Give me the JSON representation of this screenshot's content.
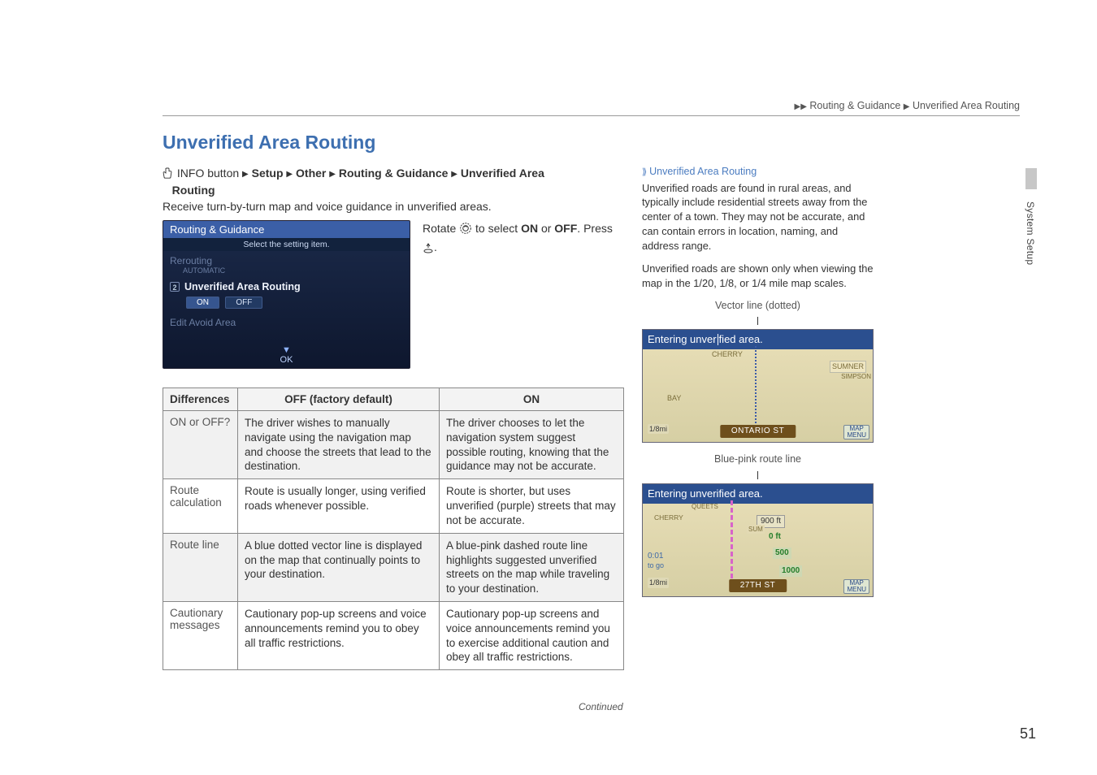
{
  "header": {
    "path_part1": "Routing & Guidance",
    "path_part2": "Unverified Area Routing"
  },
  "section_title": "Unverified Area Routing",
  "instruction": {
    "prefix": "INFO button",
    "p1": "Setup",
    "p2": "Other",
    "p3": "Routing & Guidance",
    "p4": "Unverified Area",
    "p5": "Routing"
  },
  "lead": "Receive turn-by-turn map and voice guidance in unverified areas.",
  "screenshot": {
    "title": "Routing & Guidance",
    "sub": "Select the setting item.",
    "dim1": "Rerouting",
    "dim1b": "AUTOMATIC",
    "row2": "Unverified Area Routing",
    "num": "2",
    "on": "ON",
    "off": "OFF",
    "dim3": "Edit Avoid Area",
    "ok": "OK"
  },
  "rotate": {
    "pre": "Rotate ",
    "mid": " to select ",
    "on": "ON",
    "or": " or ",
    "off": "OFF",
    "post": ". Press"
  },
  "table": {
    "h1": "Differences",
    "h2": "OFF (factory default)",
    "h3": "ON",
    "r1c1": "ON or OFF?",
    "r1c2": "The driver wishes to manually navigate using the navigation map and choose the streets that lead to the destination.",
    "r1c3": "The driver chooses to let the navigation system suggest possible routing, knowing that the guidance may not be accurate.",
    "r2c1": "Route calculation",
    "r2c2": "Route is usually longer, using verified roads whenever possible.",
    "r2c3": "Route is shorter, but uses unverified (purple) streets that may not be accurate.",
    "r3c1": "Route line",
    "r3c2": "A blue dotted vector line is displayed on the map that continually points to your destination.",
    "r3c3": "A blue-pink dashed route line highlights suggested unverified streets on the map while traveling to your destination.",
    "r4c1": "Cautionary messages",
    "r4c2": "Cautionary pop-up screens and voice announcements remind you to obey all traffic restrictions.",
    "r4c3": "Cautionary pop-up screens and voice announcements remind you to exercise additional caution and obey all traffic restrictions."
  },
  "side": {
    "heading": "Unverified Area Routing",
    "para1": "Unverified roads are found in rural areas, and typically include residential streets away from the center of a town. They may not be accurate, and can contain errors in location, naming, and address range.",
    "para2": "Unverified roads are shown only when viewing the map in the 1/20, 1/8, or 1/4 mile map scales.",
    "caption1": "Vector line (dotted)",
    "caption2": "Blue-pink route line",
    "map1": {
      "banner_a": "Entering unver",
      "banner_b": "fied area.",
      "cherry": "CHERRY",
      "sumner": "SUMNER",
      "simpson": "SIMPSON",
      "bay": "BAY",
      "pill": "ONTARIO ST",
      "scale": "1/8mi",
      "menu1": "MAP",
      "menu2": "MENU"
    },
    "map2": {
      "banner": "Entering unverified area.",
      "cherry": "CHERRY",
      "queets": "QUEETS",
      "d1": "900 ft",
      "d2": "0 ft",
      "d3": "500",
      "d4": "1000",
      "sum": "SUM",
      "t001": "0:01",
      "togo": "to go",
      "pill": "27TH ST",
      "scale": "1/8mi",
      "menu1": "MAP",
      "menu2": "MENU"
    }
  },
  "syssetup": "System Setup",
  "continued": "Continued",
  "pagenum": "51"
}
